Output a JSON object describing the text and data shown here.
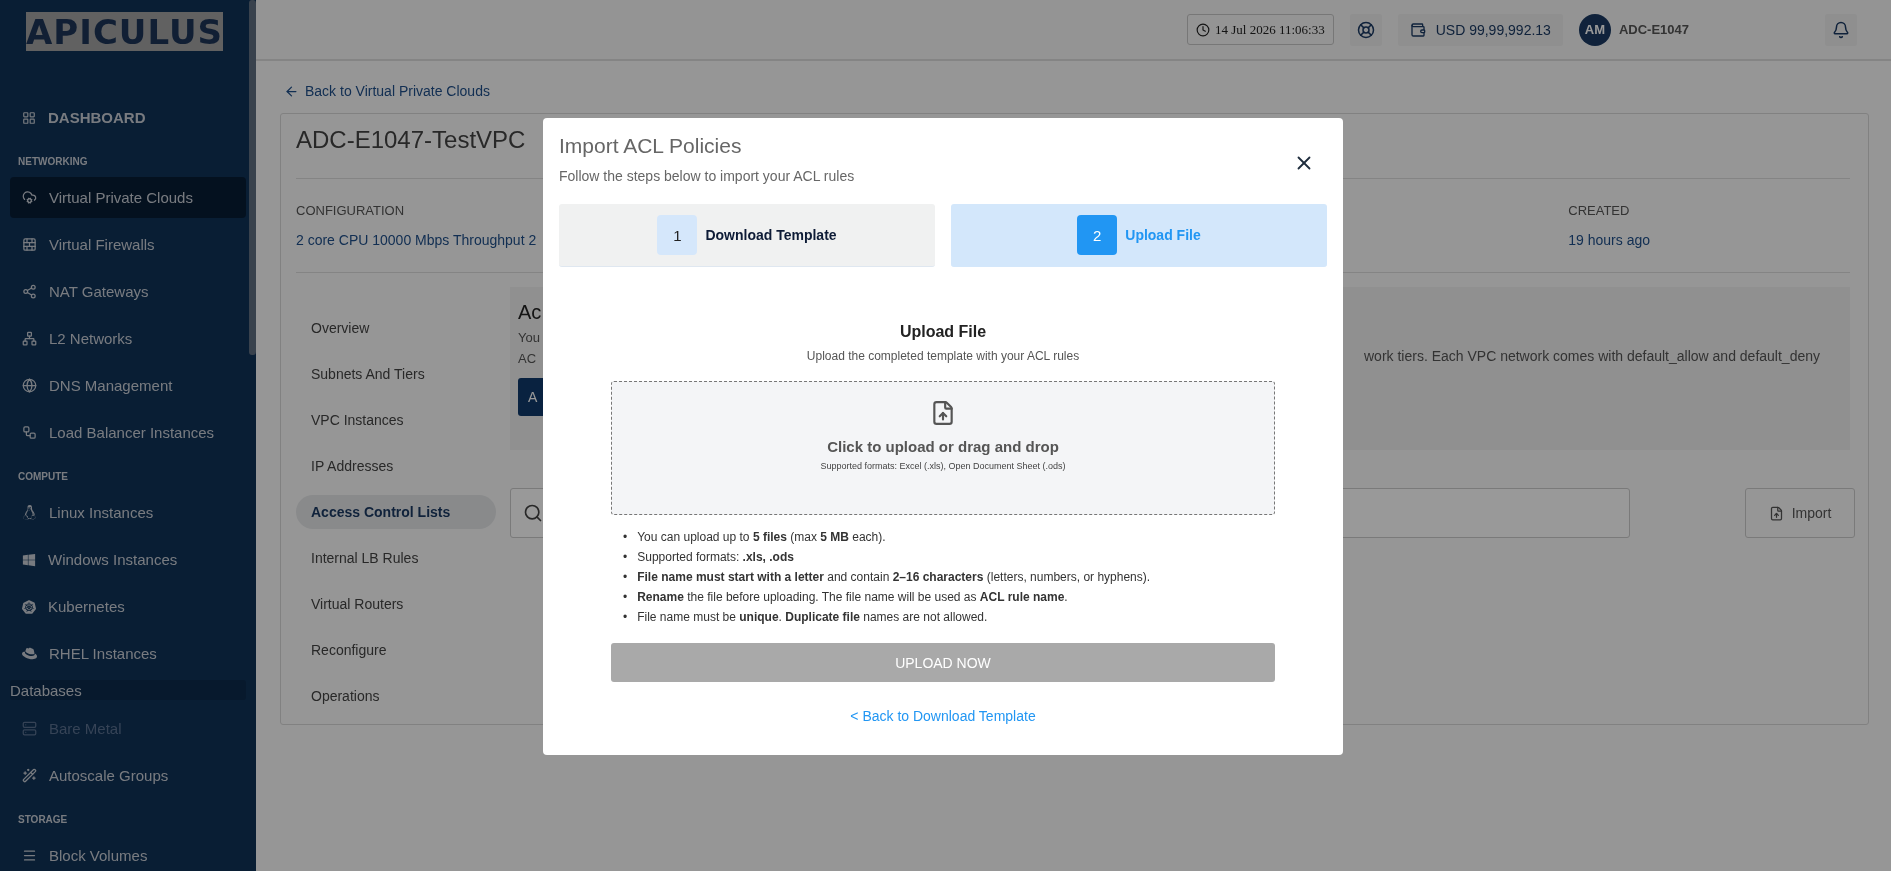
{
  "sidebar": {
    "logo": "APICULUS",
    "items": [
      {
        "kind": "top",
        "label": "DASHBOARD",
        "selected": false,
        "disabled": false
      },
      {
        "kind": "heading",
        "label": "NETWORKING"
      },
      {
        "kind": "link",
        "label": "Virtual Private Clouds",
        "selected": true,
        "disabled": false
      },
      {
        "kind": "link",
        "label": "Virtual Firewalls",
        "selected": false,
        "disabled": false
      },
      {
        "kind": "link",
        "label": "NAT Gateways",
        "selected": false,
        "disabled": false
      },
      {
        "kind": "link",
        "label": "L2 Networks",
        "selected": false,
        "disabled": false
      },
      {
        "kind": "link",
        "label": "DNS Management",
        "selected": false,
        "disabled": false
      },
      {
        "kind": "link",
        "label": "Load Balancer Instances",
        "selected": false,
        "disabled": false
      },
      {
        "kind": "heading",
        "label": "COMPUTE"
      },
      {
        "kind": "link",
        "label": "Linux Instances",
        "selected": false,
        "disabled": false
      },
      {
        "kind": "link",
        "label": "Windows Instances",
        "selected": false,
        "disabled": false
      },
      {
        "kind": "link",
        "label": "Kubernetes",
        "selected": false,
        "disabled": false
      },
      {
        "kind": "link",
        "label": "RHEL Instances",
        "selected": false,
        "disabled": false
      },
      {
        "kind": "group",
        "label": "Databases"
      },
      {
        "kind": "link",
        "label": "Bare Metal",
        "selected": false,
        "disabled": true
      },
      {
        "kind": "link",
        "label": "Autoscale Groups",
        "selected": false,
        "disabled": false
      },
      {
        "kind": "heading",
        "label": "STORAGE"
      },
      {
        "kind": "link",
        "label": "Block Volumes",
        "selected": false,
        "disabled": false
      }
    ]
  },
  "topbar": {
    "datetime": "14 Jul 2026 11:06:33",
    "balance": "USD 99,99,992.13",
    "avatar": "AM",
    "account": "ADC-E1047"
  },
  "back_link": "Back to Virtual Private Clouds",
  "vpc": {
    "title": "ADC-E1047-TestVPC",
    "details": [
      {
        "label": "CONFIGURATION",
        "value": "2 core CPU 10000 Mbps Throughput 2"
      },
      {
        "label": "CREATED",
        "value": "19 hours ago"
      }
    ],
    "tabs": [
      {
        "label": "Overview",
        "selected": false
      },
      {
        "label": "Subnets And Tiers",
        "selected": false
      },
      {
        "label": "VPC Instances",
        "selected": false
      },
      {
        "label": "IP Addresses",
        "selected": false
      },
      {
        "label": "Access Control Lists",
        "selected": true
      },
      {
        "label": "Internal LB Rules",
        "selected": false
      },
      {
        "label": "Virtual Routers",
        "selected": false
      },
      {
        "label": "Reconfigure",
        "selected": false
      },
      {
        "label": "Operations",
        "selected": false
      }
    ],
    "info": {
      "heading": "Ac",
      "line_1": "You",
      "line_2": "AC",
      "right_text": "work tiers. Each VPC network comes with default_allow and default_deny",
      "button": "A"
    },
    "import_button": "Import"
  },
  "modal": {
    "title": "Import ACL Policies",
    "subtitle": "Follow the steps below to import your ACL rules",
    "steps": [
      {
        "number": "1",
        "label": "Download Template",
        "selected": false
      },
      {
        "number": "2",
        "label": "Upload File",
        "selected": true
      }
    ],
    "heading": "Upload File",
    "description": "Upload the completed template with your ACL rules",
    "dropzone": {
      "title": "Click to upload or drag and drop",
      "hint": "Supported formats: Excel (.xls), Open Document Sheet (.ods)"
    },
    "bullet": "•",
    "rules": [
      "You can upload up to **5 files** (max **5 MB** each).",
      "Supported formats: **.xls, .ods**",
      "**File name must start with a letter** and contain **2–16 characters** (letters, numbers, or hyphens).",
      "**Rename** the file before uploading. The file name will be used as **ACL rule name**.",
      "File name must be **unique**. **Duplicate file** names are not allowed."
    ],
    "upload_button": {
      "label": "UPLOAD NOW",
      "disabled": true
    },
    "back_link": "< Back to Download Template"
  }
}
